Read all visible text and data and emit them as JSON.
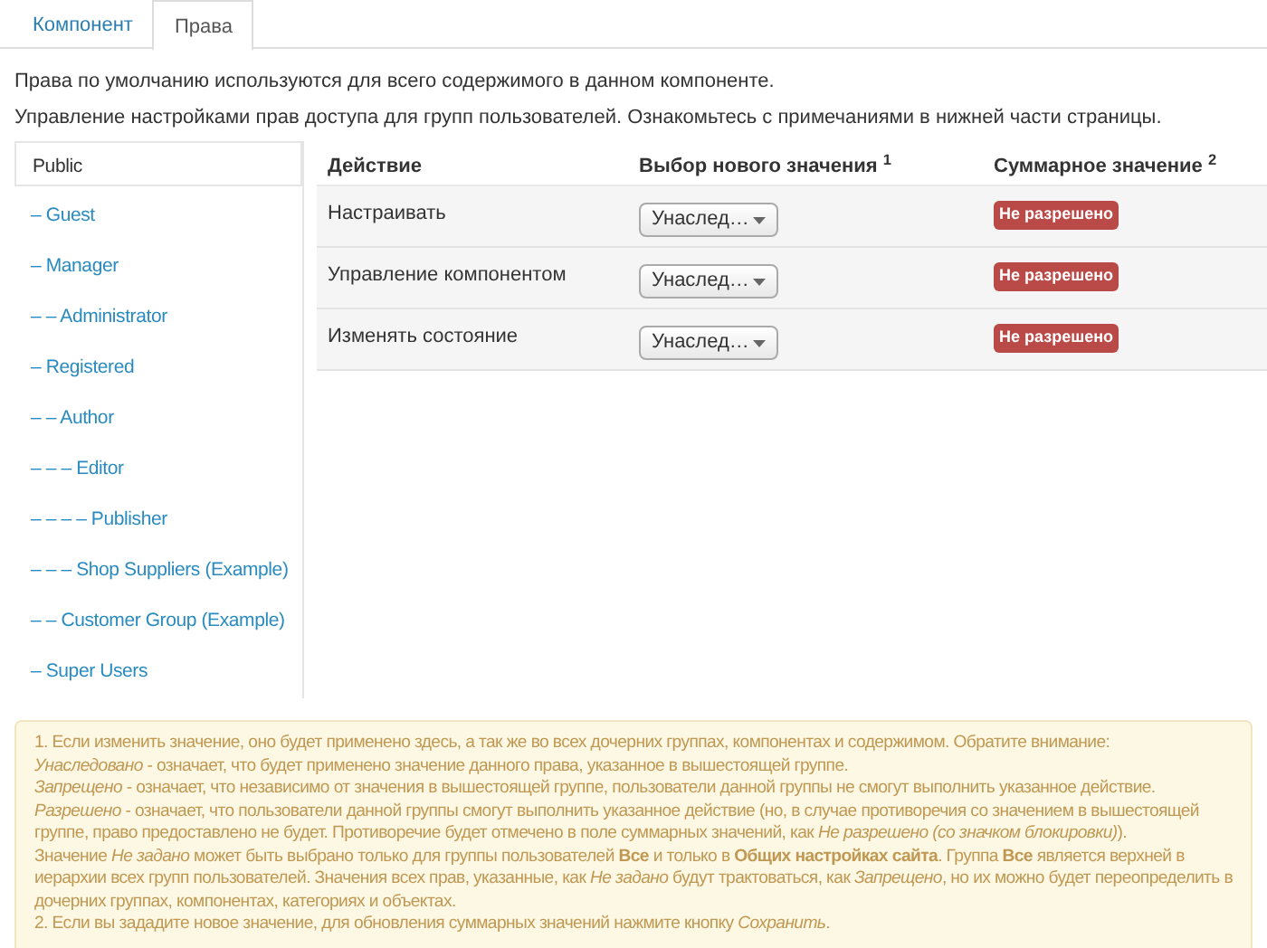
{
  "tabs": [
    {
      "label": "Компонент",
      "selected": false
    },
    {
      "label": "Права",
      "selected": true
    }
  ],
  "intro": [
    "Права по умолчанию используются для всего содержимого в данном компоненте.",
    "Управление настройками прав доступа для групп пользователей. Ознакомьтесь с примечаниями в нижней части страницы."
  ],
  "groups": [
    {
      "label": "Public",
      "selected": true
    },
    {
      "label": "– Guest",
      "selected": false
    },
    {
      "label": "– Manager",
      "selected": false
    },
    {
      "label": "– – Administrator",
      "selected": false
    },
    {
      "label": "– Registered",
      "selected": false
    },
    {
      "label": "– – Author",
      "selected": false
    },
    {
      "label": "– – – Editor",
      "selected": false
    },
    {
      "label": "– – – – Publisher",
      "selected": false
    },
    {
      "label": "– – – Shop Suppliers (Example)",
      "selected": false
    },
    {
      "label": "– – Customer Group (Example)",
      "selected": false
    },
    {
      "label": "– Super Users",
      "selected": false
    }
  ],
  "table": {
    "columns": [
      "Действие",
      "Выбор нового значения $^{1}$",
      "Суммарное значение $^{2}$"
    ],
    "rows": [
      {
        "action": "Настраивать",
        "select": "Унаслед…",
        "result": "Не разрешено"
      },
      {
        "action": "Управление компонентом",
        "select": "Унаслед…",
        "result": "Не разрешено"
      },
      {
        "action": "Изменять состояние",
        "select": "Унаслед…",
        "result": "Не разрешено"
      }
    ]
  },
  "notes": [
    "1. Если изменить значение, оно будет применено здесь, а так же во всех дочерних группах, компонентах и содержимом. Обратите внимание:",
    "*Унаследовано* - означает, что будет применено значение данного права, указанное в вышестоящей группе.",
    "*Запрещено* - означает, что независимо от значения в вышестоящей группе, пользователи данной группы не смогут выполнить указанное действие.",
    "*Разрешено* - означает, что пользователи данной группы смогут выполнить указанное действие (но, в случае противоречия со значением в вышестоящей группе, право предоставлено не будет. Противоречие будет отмечено в поле суммарных значений, как *Не разрешено (со значком блокировки)*).",
    "Значение *Не задано* может быть выбрано только для группы пользователей **Все** и только в **Общих настройках сайта**. Группа **Все** является верхней в иерархии всех групп пользователей. Значения всех прав, указанные, как *Не задано* будут трактоваться, как *Запрещено*, но их можно будет переопределить в дочерних группах, компонентах, категориях и объектах.",
    "2. Если вы зададите новое значение, для обновления суммарных значений нажмите кнопку *Сохранить*."
  ]
}
